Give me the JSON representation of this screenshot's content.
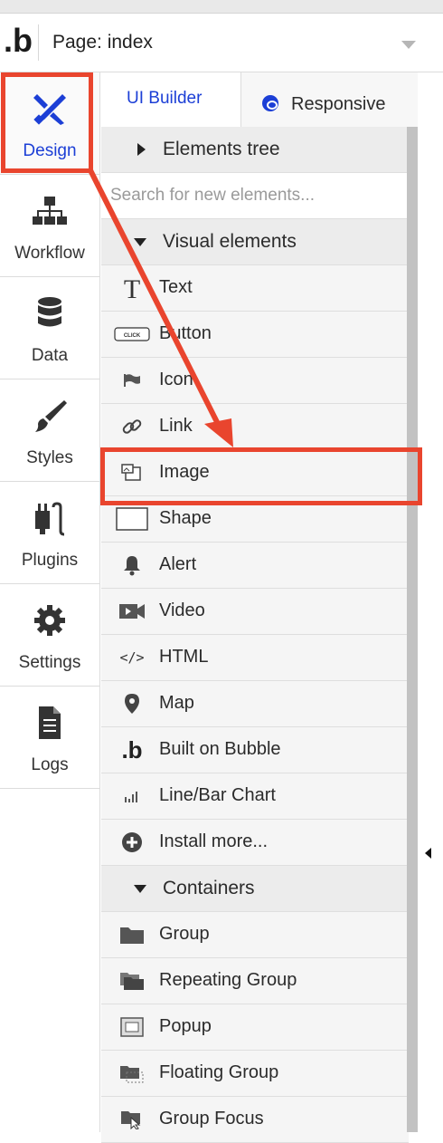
{
  "page_bar": {
    "label": "Page: index"
  },
  "sidebar": {
    "items": [
      {
        "label": "Design",
        "icon": "design-icon",
        "active": true
      },
      {
        "label": "Workflow",
        "icon": "workflow-icon"
      },
      {
        "label": "Data",
        "icon": "database-icon"
      },
      {
        "label": "Styles",
        "icon": "brush-icon"
      },
      {
        "label": "Plugins",
        "icon": "plug-icon"
      },
      {
        "label": "Settings",
        "icon": "gear-icon"
      },
      {
        "label": "Logs",
        "icon": "document-icon"
      }
    ]
  },
  "tabs": {
    "ui_builder": "UI Builder",
    "responsive": "Responsive"
  },
  "tree": {
    "elements_tree": "Elements tree"
  },
  "search": {
    "placeholder": "Search for new elements..."
  },
  "visual_elements": {
    "header": "Visual elements",
    "items": [
      {
        "label": "Text",
        "icon": "text-icon"
      },
      {
        "label": "Button",
        "icon": "button-icon",
        "icon_text": "CLICK"
      },
      {
        "label": "Icon",
        "icon": "flag-icon"
      },
      {
        "label": "Link",
        "icon": "link-icon"
      },
      {
        "label": "Image",
        "icon": "image-icon"
      },
      {
        "label": "Shape",
        "icon": "shape-icon"
      },
      {
        "label": "Alert",
        "icon": "bell-icon"
      },
      {
        "label": "Video",
        "icon": "video-icon"
      },
      {
        "label": "HTML",
        "icon": "code-icon",
        "icon_text": "</>"
      },
      {
        "label": "Map",
        "icon": "map-pin-icon"
      },
      {
        "label": "Built on Bubble",
        "icon": "bubble-logo-icon"
      },
      {
        "label": "Line/Bar Chart",
        "icon": "chart-icon"
      },
      {
        "label": "Install more...",
        "icon": "plus-circle-icon"
      }
    ]
  },
  "containers": {
    "header": "Containers",
    "items": [
      {
        "label": "Group",
        "icon": "folder-icon"
      },
      {
        "label": "Repeating Group",
        "icon": "folders-icon"
      },
      {
        "label": "Popup",
        "icon": "popup-icon"
      },
      {
        "label": "Floating Group",
        "icon": "floating-folder-icon"
      },
      {
        "label": "Group Focus",
        "icon": "group-focus-icon"
      }
    ]
  },
  "colors": {
    "accent": "#1c3fd6",
    "highlight": "#e9452e"
  }
}
